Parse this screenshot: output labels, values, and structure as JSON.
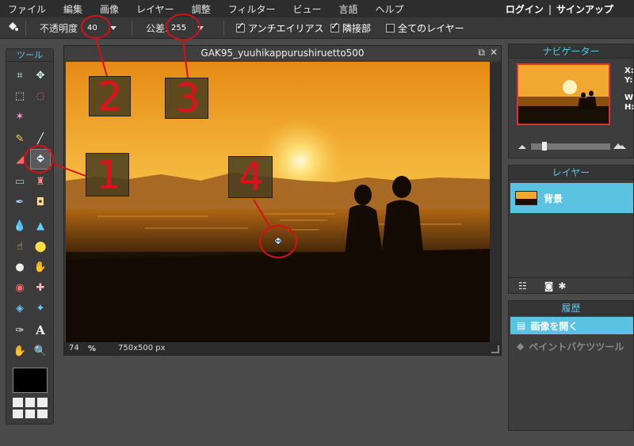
{
  "menu": {
    "items": [
      "ファイル",
      "編集",
      "画像",
      "レイヤー",
      "調整",
      "フィルター",
      "ビュー",
      "言語",
      "ヘルプ"
    ],
    "login": "ログイン",
    "separator": "|",
    "signup": "サインアップ"
  },
  "options": {
    "opacity_label": "不透明度",
    "opacity_value": "40",
    "tolerance_label": "公差:",
    "tolerance_value": "255",
    "antialias_label": "アンチエイリアス",
    "antialias_checked": true,
    "contiguous_label": "隣接部",
    "contiguous_checked": true,
    "all_layers_label": "全てのレイヤー",
    "all_layers_checked": false
  },
  "tools": {
    "title": "ツール",
    "active": "paint-bucket-icon",
    "icons": [
      "crop-icon",
      "move-icon",
      "marquee-icon",
      "lasso-icon",
      "magic-wand-icon",
      "pencil-icon",
      "brush-icon",
      "eraser-icon",
      "paint-bucket-icon",
      "gradient-icon",
      "stamp-icon",
      "color-replace-icon",
      "sponge-icon",
      "blur-icon",
      "sharpen-icon",
      "smudge-icon",
      "dodge-icon",
      "burn-icon",
      "zoom-icon",
      "red-eye-icon",
      "spot-heal-icon",
      "bloat-icon",
      "pinch-icon",
      "color-picker-icon",
      "text-icon",
      "hand-icon",
      "magnifier-icon"
    ],
    "foreground_color": "#000000"
  },
  "document": {
    "title": "GAK95_yuuhikappurushiruetto500",
    "zoom": "74",
    "zoom_unit": "%",
    "dimensions": "750x500 px"
  },
  "annotations": {
    "labels": [
      "1",
      "2",
      "3",
      "4"
    ],
    "accent": "#e0101a"
  },
  "navigator": {
    "title": "ナビゲーター",
    "x_label": "X:",
    "y_label": "Y:",
    "w_label": "W",
    "h_label": "H:"
  },
  "layers": {
    "title": "レイヤー",
    "items": [
      {
        "name": "背景"
      }
    ]
  },
  "history": {
    "title": "履歴",
    "items": [
      {
        "label": "画像を開く",
        "active": true
      },
      {
        "label": "ペイントバケツツール",
        "active": false
      }
    ]
  },
  "colors": {
    "accent": "#55c8e8",
    "selection": "#5ac3e2",
    "menubar": "#2d2d2d"
  }
}
